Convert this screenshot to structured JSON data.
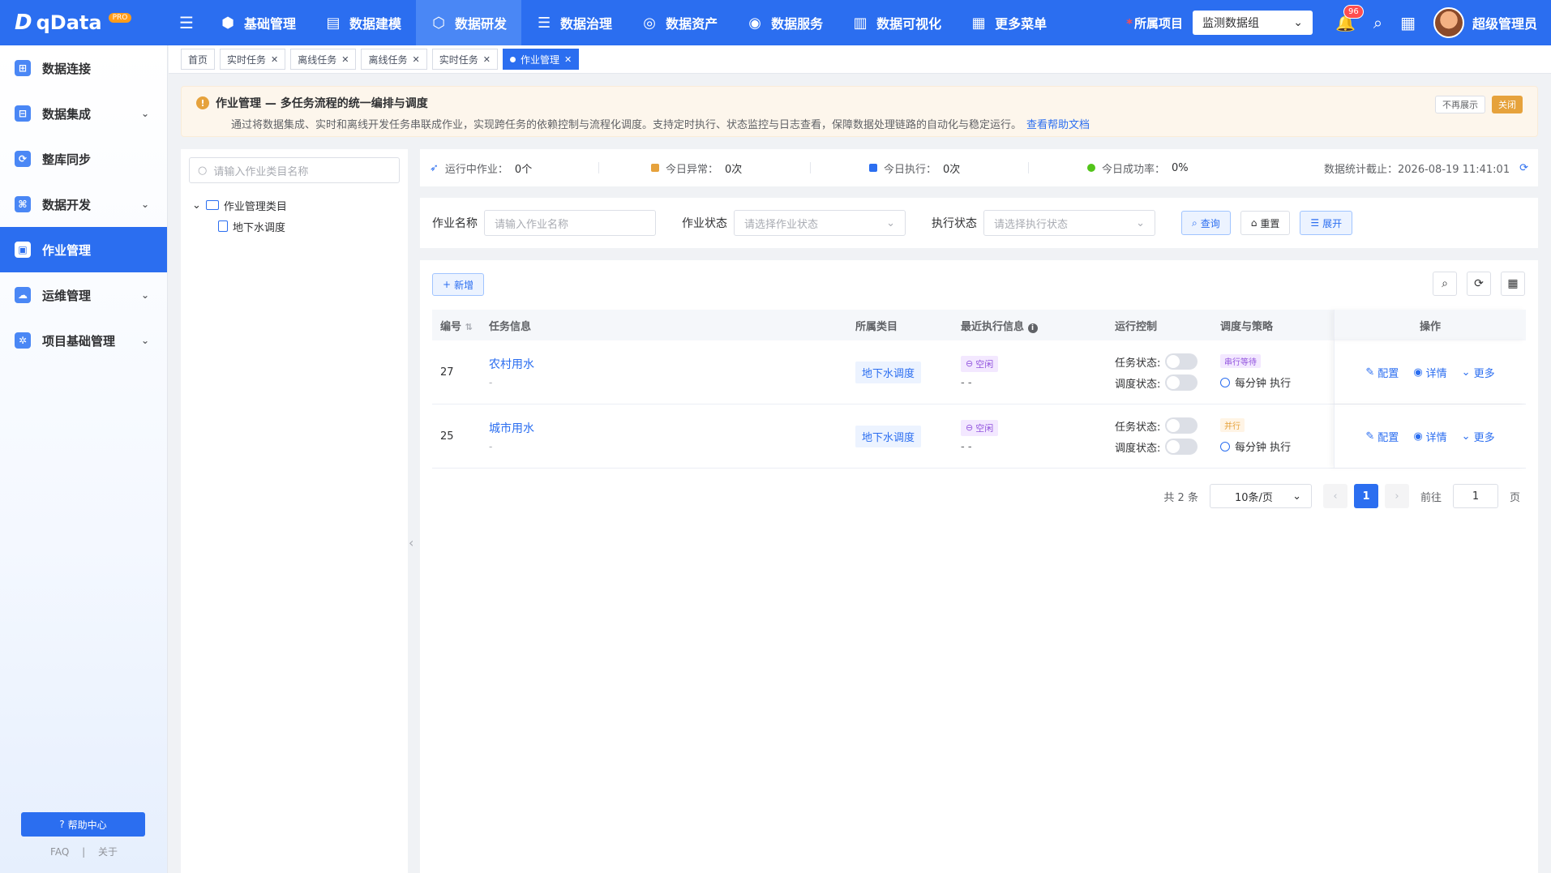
{
  "brand": {
    "name": "qData",
    "edition": "PRO"
  },
  "nav": [
    {
      "label": "基础管理",
      "icon": "cube-icon",
      "glyph": "⬢"
    },
    {
      "label": "数据建模",
      "icon": "book-icon",
      "glyph": "▤"
    },
    {
      "label": "数据研发",
      "icon": "box-icon",
      "glyph": "⬡",
      "active": true
    },
    {
      "label": "数据治理",
      "icon": "database-icon",
      "glyph": "☰"
    },
    {
      "label": "数据资产",
      "icon": "target-icon",
      "glyph": "◎"
    },
    {
      "label": "数据服务",
      "icon": "service-icon",
      "glyph": "◉"
    },
    {
      "label": "数据可视化",
      "icon": "chart-icon",
      "glyph": "▥"
    },
    {
      "label": "更多菜单",
      "icon": "grid-icon",
      "glyph": "▦"
    }
  ],
  "header": {
    "project_label": "所属项目",
    "project_value": "监测数据组",
    "notifications": "96",
    "user": "超级管理员"
  },
  "sidebar": {
    "items": [
      {
        "label": "数据连接",
        "glyph": "⊞",
        "expandable": false
      },
      {
        "label": "数据集成",
        "glyph": "⊟",
        "expandable": true
      },
      {
        "label": "整库同步",
        "glyph": "⟳",
        "expandable": false
      },
      {
        "label": "数据开发",
        "glyph": "⌘",
        "expandable": true
      },
      {
        "label": "作业管理",
        "glyph": "▣",
        "expandable": false,
        "active": true
      },
      {
        "label": "运维管理",
        "glyph": "☁",
        "expandable": true
      },
      {
        "label": "项目基础管理",
        "glyph": "✲",
        "expandable": true
      }
    ],
    "help": "帮助中心",
    "faq": "FAQ",
    "sep": "|",
    "about": "关于"
  },
  "tabs": [
    {
      "label": "首页",
      "closable": false
    },
    {
      "label": "实时任务",
      "closable": true
    },
    {
      "label": "离线任务",
      "closable": true
    },
    {
      "label": "离线任务",
      "closable": true
    },
    {
      "label": "实时任务",
      "closable": true
    },
    {
      "label": "作业管理",
      "closable": true,
      "active": true
    }
  ],
  "alert": {
    "title": "作业管理 — 多任务流程的统一编排与调度",
    "desc": "通过将数据集成、实时和离线开发任务串联成作业，实现跨任务的依赖控制与流程化调度。支持定时执行、状态监控与日志查看，保障数据处理链路的自动化与稳定运行。",
    "link": "查看帮助文档",
    "dismiss": "不再展示",
    "close": "关闭"
  },
  "tree": {
    "placeholder": "请输入作业类目名称",
    "root": "作业管理类目",
    "child": "地下水调度"
  },
  "stats": {
    "running_label": "运行中作业：",
    "running_value": "0个",
    "abnormal_label": "今日异常：",
    "abnormal_value": "0次",
    "exec_label": "今日执行：",
    "exec_value": "0次",
    "success_label": "今日成功率：",
    "success_value": "0%",
    "as_of": "数据统计截止：2026-08-19 11:41:01"
  },
  "filters": {
    "name_label": "作业名称",
    "name_placeholder": "请输入作业名称",
    "status_label": "作业状态",
    "status_placeholder": "请选择作业状态",
    "exec_label": "执行状态",
    "exec_placeholder": "请选择执行状态",
    "search": "查询",
    "reset": "重置",
    "expand": "展开"
  },
  "table": {
    "add": "新增",
    "columns": {
      "id": "编号",
      "info": "任务信息",
      "category": "所属类目",
      "last_exec": "最近执行信息",
      "control": "运行控制",
      "schedule": "调度与策略",
      "ops": "操作"
    },
    "rows": [
      {
        "id": "27",
        "name": "农村用水",
        "sub": "-",
        "category": "地下水调度",
        "state": "空闲",
        "exec_sub": "-  -",
        "task_state_label": "任务状态:",
        "sched_state_label": "调度状态:",
        "strategy": "串行等待",
        "strategy_type": "serial",
        "cron": "每分钟 执行",
        "op_config": "配置",
        "op_detail": "详情",
        "op_more": "更多"
      },
      {
        "id": "25",
        "name": "城市用水",
        "sub": "-",
        "category": "地下水调度",
        "state": "空闲",
        "exec_sub": "-  -",
        "task_state_label": "任务状态:",
        "sched_state_label": "调度状态:",
        "strategy": "并行",
        "strategy_type": "parallel",
        "cron": "每分钟 执行",
        "op_config": "配置",
        "op_detail": "详情",
        "op_more": "更多"
      }
    ]
  },
  "pager": {
    "total": "共 2 条",
    "size": "10条/页",
    "current": "1",
    "goto": "前往",
    "page_input": "1",
    "page_unit": "页"
  }
}
